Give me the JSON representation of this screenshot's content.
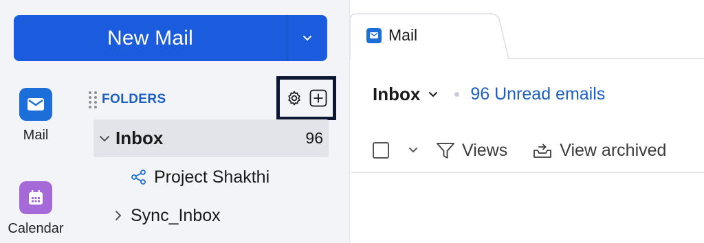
{
  "compose": {
    "new_mail_label": "New Mail"
  },
  "apps": [
    {
      "label": "Mail",
      "icon": "mail-icon",
      "color": "#1c6fd8"
    },
    {
      "label": "Calendar",
      "icon": "calendar-icon",
      "color": "#a66ad8"
    }
  ],
  "folders": {
    "title": "FOLDERS",
    "items": [
      {
        "name": "Inbox",
        "count": "96",
        "expanded": true,
        "selected": true
      },
      {
        "name": "Project Shakthi",
        "shared": true
      },
      {
        "name": "Sync_Inbox",
        "expanded": false
      }
    ]
  },
  "tab": {
    "label": "Mail"
  },
  "mail_view": {
    "folder_title": "Inbox",
    "unread_text": "96 Unread emails",
    "toolbar": {
      "views_label": "Views",
      "archived_label": "View archived"
    }
  },
  "colors": {
    "accent": "#1b5bde",
    "link": "#1c5fc4",
    "highlight_border": "#0c1733"
  }
}
